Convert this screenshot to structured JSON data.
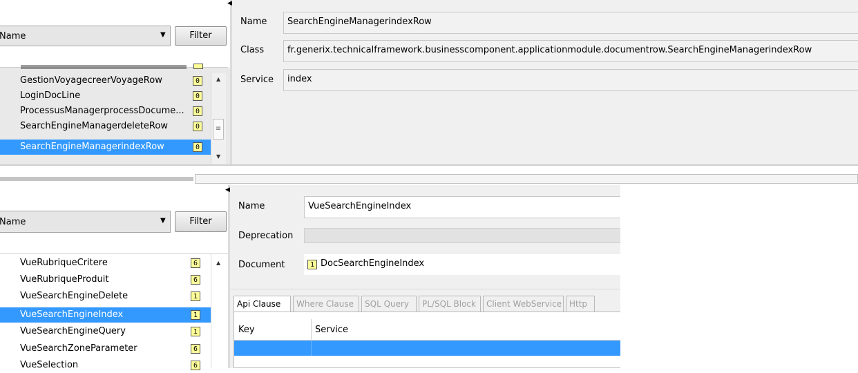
{
  "top": {
    "left": {
      "sort_field": "Name",
      "filter_label": "Filter",
      "items": [
        {
          "label": "GestionVoyagecreerVoyageRow",
          "count": "0"
        },
        {
          "label": "LoginDocLine",
          "count": "0"
        },
        {
          "label": "ProcessusManagerprocessDocume...",
          "count": "0"
        },
        {
          "label": "SearchEngineManagerdeleteRow",
          "count": "0"
        },
        {
          "label": "SearchEngineManagerindexRow",
          "count": "0",
          "selected": true
        }
      ]
    },
    "right": {
      "name_label": "Name",
      "name_value": "SearchEngineManagerindexRow",
      "class_label": "Class",
      "class_value": "fr.generix.technicalframework.businesscomponent.applicationmodule.documentrow.SearchEngineManagerindexRow",
      "service_label": "Service",
      "service_value": "index"
    }
  },
  "bottom": {
    "left": {
      "sort_field": "Name",
      "filter_label": "Filter",
      "items": [
        {
          "label": "VueRubriqueCritere",
          "count": "6"
        },
        {
          "label": "VueRubriqueProduit",
          "count": "6"
        },
        {
          "label": "VueSearchEngineDelete",
          "count": "1"
        },
        {
          "label": "VueSearchEngineIndex",
          "count": "1",
          "selected": true
        },
        {
          "label": "VueSearchEngineQuery",
          "count": "1"
        },
        {
          "label": "VueSearchZoneParameter",
          "count": "6"
        },
        {
          "label": "VueSelection",
          "count": "6"
        }
      ]
    },
    "right": {
      "name_label": "Name",
      "name_value": "VueSearchEngineIndex",
      "deprecation_label": "Deprecation",
      "deprecation_value": "",
      "document_label": "Document",
      "document_count": "1",
      "document_value": "DocSearchEngineIndex",
      "tabs": [
        "Api Clause",
        "Where Clause",
        "SQL Query",
        "PL/SQL Block",
        "Client WebService",
        "Http"
      ],
      "table_headers": [
        "Key",
        "Service"
      ]
    }
  }
}
